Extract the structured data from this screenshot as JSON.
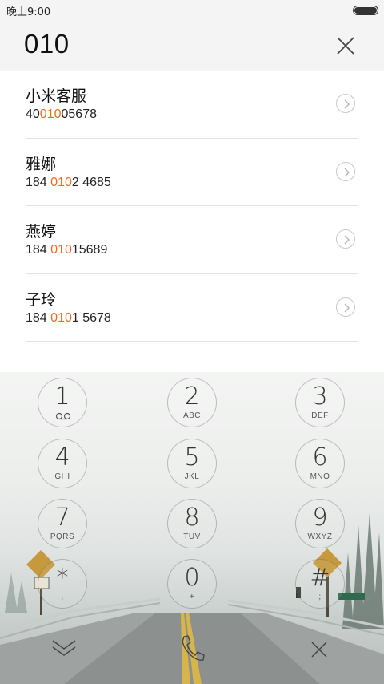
{
  "status_bar": {
    "time": "晚上9:00",
    "battery_level": 1.0
  },
  "search": {
    "query": "010"
  },
  "results": [
    {
      "name": "小米客服",
      "number_pre": "40",
      "number_match": "010",
      "number_post": "05678"
    },
    {
      "name": "雅娜",
      "number_pre": "184 ",
      "number_match": "010",
      "number_post": "2 4685"
    },
    {
      "name": "燕婷",
      "number_pre": "184 ",
      "number_match": "010",
      "number_post": "15689"
    },
    {
      "name": "子玲",
      "number_pre": "184 ",
      "number_match": "010",
      "number_post": "1 5678"
    }
  ],
  "keypad": [
    {
      "digit": "1",
      "letters": "",
      "sub_icon": "voicemail-icon"
    },
    {
      "digit": "2",
      "letters": "ABC"
    },
    {
      "digit": "3",
      "letters": "DEF"
    },
    {
      "digit": "4",
      "letters": "GHI"
    },
    {
      "digit": "5",
      "letters": "JKL"
    },
    {
      "digit": "6",
      "letters": "MNO"
    },
    {
      "digit": "7",
      "letters": "PQRS"
    },
    {
      "digit": "8",
      "letters": "TUV"
    },
    {
      "digit": "9",
      "letters": "WXYZ"
    },
    {
      "digit": "*",
      "letters": ","
    },
    {
      "digit": "0",
      "letters": "+"
    },
    {
      "digit": "#",
      "letters": ";"
    }
  ],
  "bottom_bar": {
    "left": "collapse-icon",
    "center": "phone-icon",
    "right": "delete-icon"
  },
  "colors": {
    "highlight": "#f26b1d",
    "list_bg": "#ffffff",
    "header_bg": "#f4f4f4"
  }
}
